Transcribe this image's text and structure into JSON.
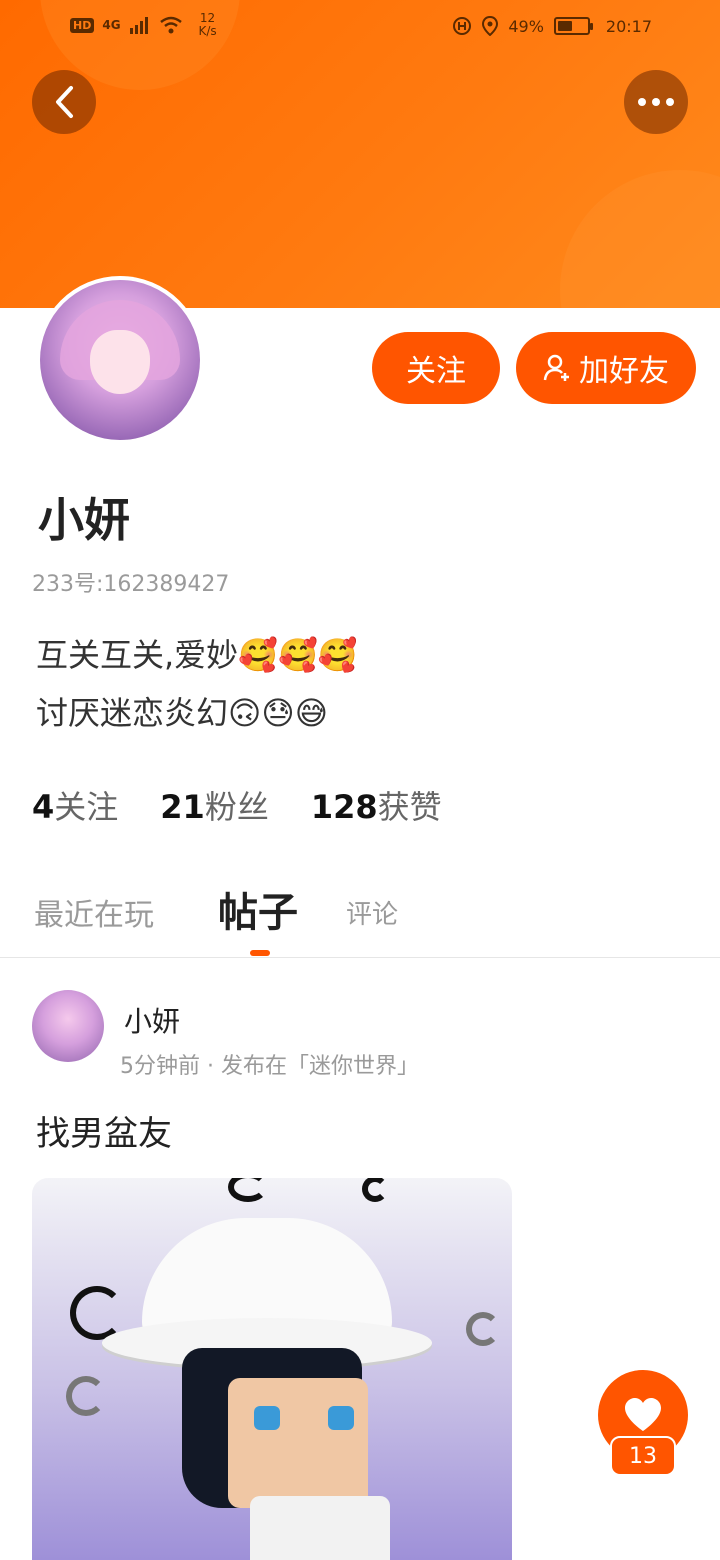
{
  "status_bar": {
    "hd": "HD",
    "network": "4G",
    "speed": "12 K/s",
    "battery_percent": "49%",
    "battery_level": 0.49,
    "time": "20:17"
  },
  "profile": {
    "name": "小妍",
    "id_text": "233号:162389427",
    "bio_line1": "互关互关,爱妙🥰🥰🥰",
    "bio_line2": "讨厌迷恋炎幻🙃😓😅"
  },
  "actions": {
    "follow_label": "关注",
    "add_friend_label": "加好友"
  },
  "stats": [
    {
      "num": "4",
      "label": "关注"
    },
    {
      "num": "21",
      "label": "粉丝"
    },
    {
      "num": "128",
      "label": "获赞"
    }
  ],
  "tabs": [
    {
      "label": "最近在玩"
    },
    {
      "label": "帖子"
    },
    {
      "label": "评论"
    }
  ],
  "post": {
    "author": "小妍",
    "meta": "5分钟前 · 发布在「迷你世界」",
    "title": "找男盆友",
    "likes": "13"
  },
  "colors": {
    "accent": "#ff5500",
    "banner": "#ff7a10"
  }
}
